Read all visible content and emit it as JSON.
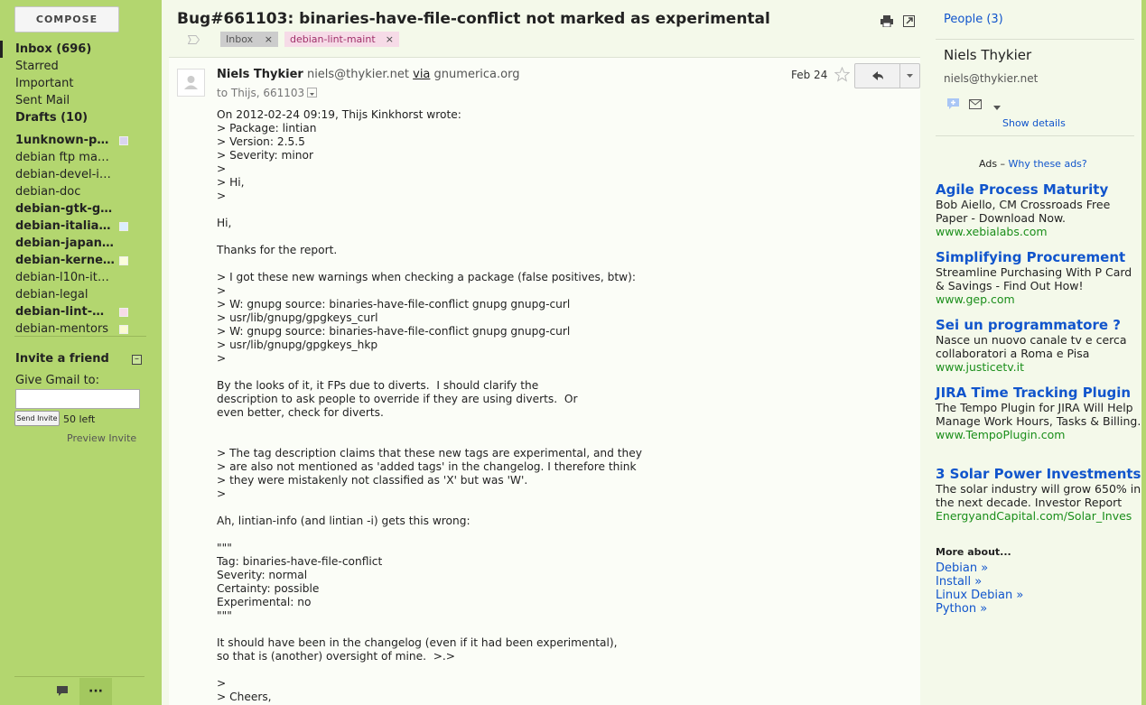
{
  "compose_label": "COMPOSE",
  "nav": {
    "inbox": "Inbox (696)",
    "starred": "Starred",
    "important": "Important",
    "sent": "Sent Mail",
    "drafts": "Drafts (10)",
    "labels": [
      {
        "text": "1unknown-pa…",
        "bold": true,
        "color": "#d9d4ef"
      },
      {
        "text": "debian ftp mast…",
        "bold": false,
        "color": ""
      },
      {
        "text": "debian-devel-it…",
        "bold": false,
        "color": ""
      },
      {
        "text": "debian-doc",
        "bold": false,
        "color": ""
      },
      {
        "text": "debian-gtk-g…",
        "bold": true,
        "color": ""
      },
      {
        "text": "debian-italian…",
        "bold": true,
        "color": "#dbeefd"
      },
      {
        "text": "debian-japan…",
        "bold": true,
        "color": ""
      },
      {
        "text": "debian-kerne…",
        "bold": true,
        "color": "#fbfddc"
      },
      {
        "text": "debian-l10n-ital…",
        "bold": false,
        "color": ""
      },
      {
        "text": "debian-legal",
        "bold": false,
        "color": ""
      },
      {
        "text": "debian-lint-m…",
        "bold": true,
        "color": "#f6dbe7"
      },
      {
        "text": "debian-mentors",
        "bold": false,
        "color": "#fbfbd0"
      }
    ]
  },
  "invite": {
    "title": "Invite a friend",
    "give_label": "Give Gmail to:",
    "send_label": "Send Invite",
    "left_count": "50 left",
    "preview": "Preview Invite"
  },
  "thread": {
    "subject": "Bug#661103: binaries-have-file-conflict not marked as experimental",
    "tags": [
      {
        "label": "Inbox",
        "close": "×"
      },
      {
        "label": "debian-lint-maint",
        "close": "×"
      }
    ]
  },
  "message": {
    "sender_name": "Niels Thykier",
    "sender_email": "niels@thykier.net",
    "via": "via",
    "via_domain": "gnumerica.org",
    "to": "to Thijs, 661103",
    "date": "Feb 24",
    "body_lines": [
      "On 2012-02-24 09:19, Thijs Kinkhorst wrote:",
      "> Package: lintian",
      "> Version: 2.5.5",
      "> Severity: minor",
      ">",
      "> Hi,",
      ">",
      "",
      "Hi,",
      "",
      "Thanks for the report.",
      "",
      "> I got these new warnings when checking a package (false positives, btw):",
      ">",
      "> W: gnupg source: binaries-have-file-conflict gnupg gnupg-curl",
      "> usr/lib/gnupg/gpgkeys_curl",
      "> W: gnupg source: binaries-have-file-conflict gnupg gnupg-curl",
      "> usr/lib/gnupg/gpgkeys_hkp",
      ">",
      "",
      "By the looks of it, it FPs due to diverts.  I should clarify the",
      "description to ask people to override if they are using diverts.  Or",
      "even better, check for diverts.",
      "",
      "",
      "> The tag description claims that these new tags are experimental, and they",
      "> are also not mentioned as 'added tags' in the changelog. I therefore think",
      "> they were mistakenly not classified as 'X' but was 'W'.",
      ">",
      "",
      "Ah, lintian-info (and lintian -i) gets this wrong:",
      "",
      "\"\"\"",
      "Tag: binaries-have-file-conflict",
      "Severity: normal",
      "Certainty: possible",
      "Experimental: no",
      "\"\"\"",
      "",
      "It should have been in the changelog (even if it had been experimental),",
      "so that is (another) oversight of mine.  >.>",
      "",
      ">",
      "> Cheers,"
    ]
  },
  "people": {
    "header": "People (3)",
    "contact_name": "Niels Thykier",
    "contact_email": "niels@thykier.net",
    "show_details": "Show details"
  },
  "ads": {
    "label": "Ads –",
    "why": "Why these ads?",
    "items": [
      {
        "title": "Agile Process Maturity",
        "desc": "Bob Aiello, CM Crossroads Free Paper - Download Now.",
        "url": "www.xebialabs.com"
      },
      {
        "title": "Simplifying Procurement",
        "desc": "Streamline Purchasing With P Card & Savings - Find Out How!",
        "url": "www.gep.com"
      },
      {
        "title": "Sei un programmatore ?",
        "desc": "Nasce un nuovo canale tv e cerca collaboratori a Roma e Pisa",
        "url": "www.justicetv.it"
      },
      {
        "title": "JIRA Time Tracking Plugin",
        "desc": "The Tempo Plugin for JIRA Will Help Manage Work Hours, Tasks & Billing.",
        "url": "www.TempoPlugin.com"
      },
      {
        "title": "3 Solar Power Investments",
        "desc": "The solar industry will grow 650% in the next decade. Investor Report",
        "url": "EnergyandCapital.com/Solar_Inves"
      }
    ],
    "more_about": "More about...",
    "more_links": [
      "Debian »",
      "Install »",
      "Linux Debian »",
      "Python »"
    ]
  }
}
